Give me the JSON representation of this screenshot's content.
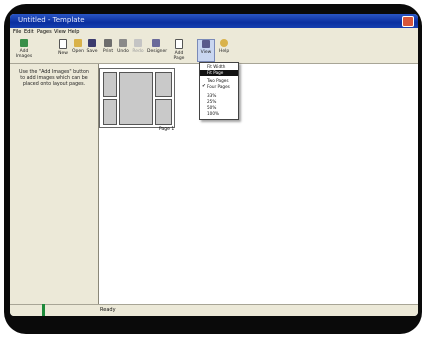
{
  "window": {
    "title": "Untitled - Template"
  },
  "menu": [
    "File",
    "Edit",
    "Pages",
    "View",
    "Help"
  ],
  "toolbar": {
    "add_images": "Add Images",
    "new": "New",
    "open": "Open",
    "save": "Save",
    "print": "Print",
    "undo": "Undo",
    "redo": "Redo",
    "designer": "Designer",
    "add_page": "Add Page",
    "view": "View",
    "help": "Help"
  },
  "side_panel": {
    "hint": "Use the \"Add Images\" button to add images which can be placed onto layout pages."
  },
  "canvas": {
    "page_label": "Page 1"
  },
  "view_menu": {
    "items": [
      {
        "label": "Fit Width",
        "selected": false,
        "checked": false
      },
      {
        "label": "Fit Page",
        "selected": true,
        "checked": false
      },
      {
        "label": "Two Pages",
        "selected": false,
        "checked": false
      },
      {
        "label": "Four Pages",
        "selected": false,
        "checked": true
      },
      {
        "label": "33%",
        "selected": false,
        "checked": false
      },
      {
        "label": "25%",
        "selected": false,
        "checked": false
      },
      {
        "label": "50%",
        "selected": false,
        "checked": false
      },
      {
        "label": "100%",
        "selected": false,
        "checked": false
      }
    ]
  },
  "status": {
    "text": "Ready"
  },
  "colors": {
    "titlebar": "#0a2fa0",
    "chrome": "#ece9d8",
    "menu_highlight": "#111111"
  }
}
